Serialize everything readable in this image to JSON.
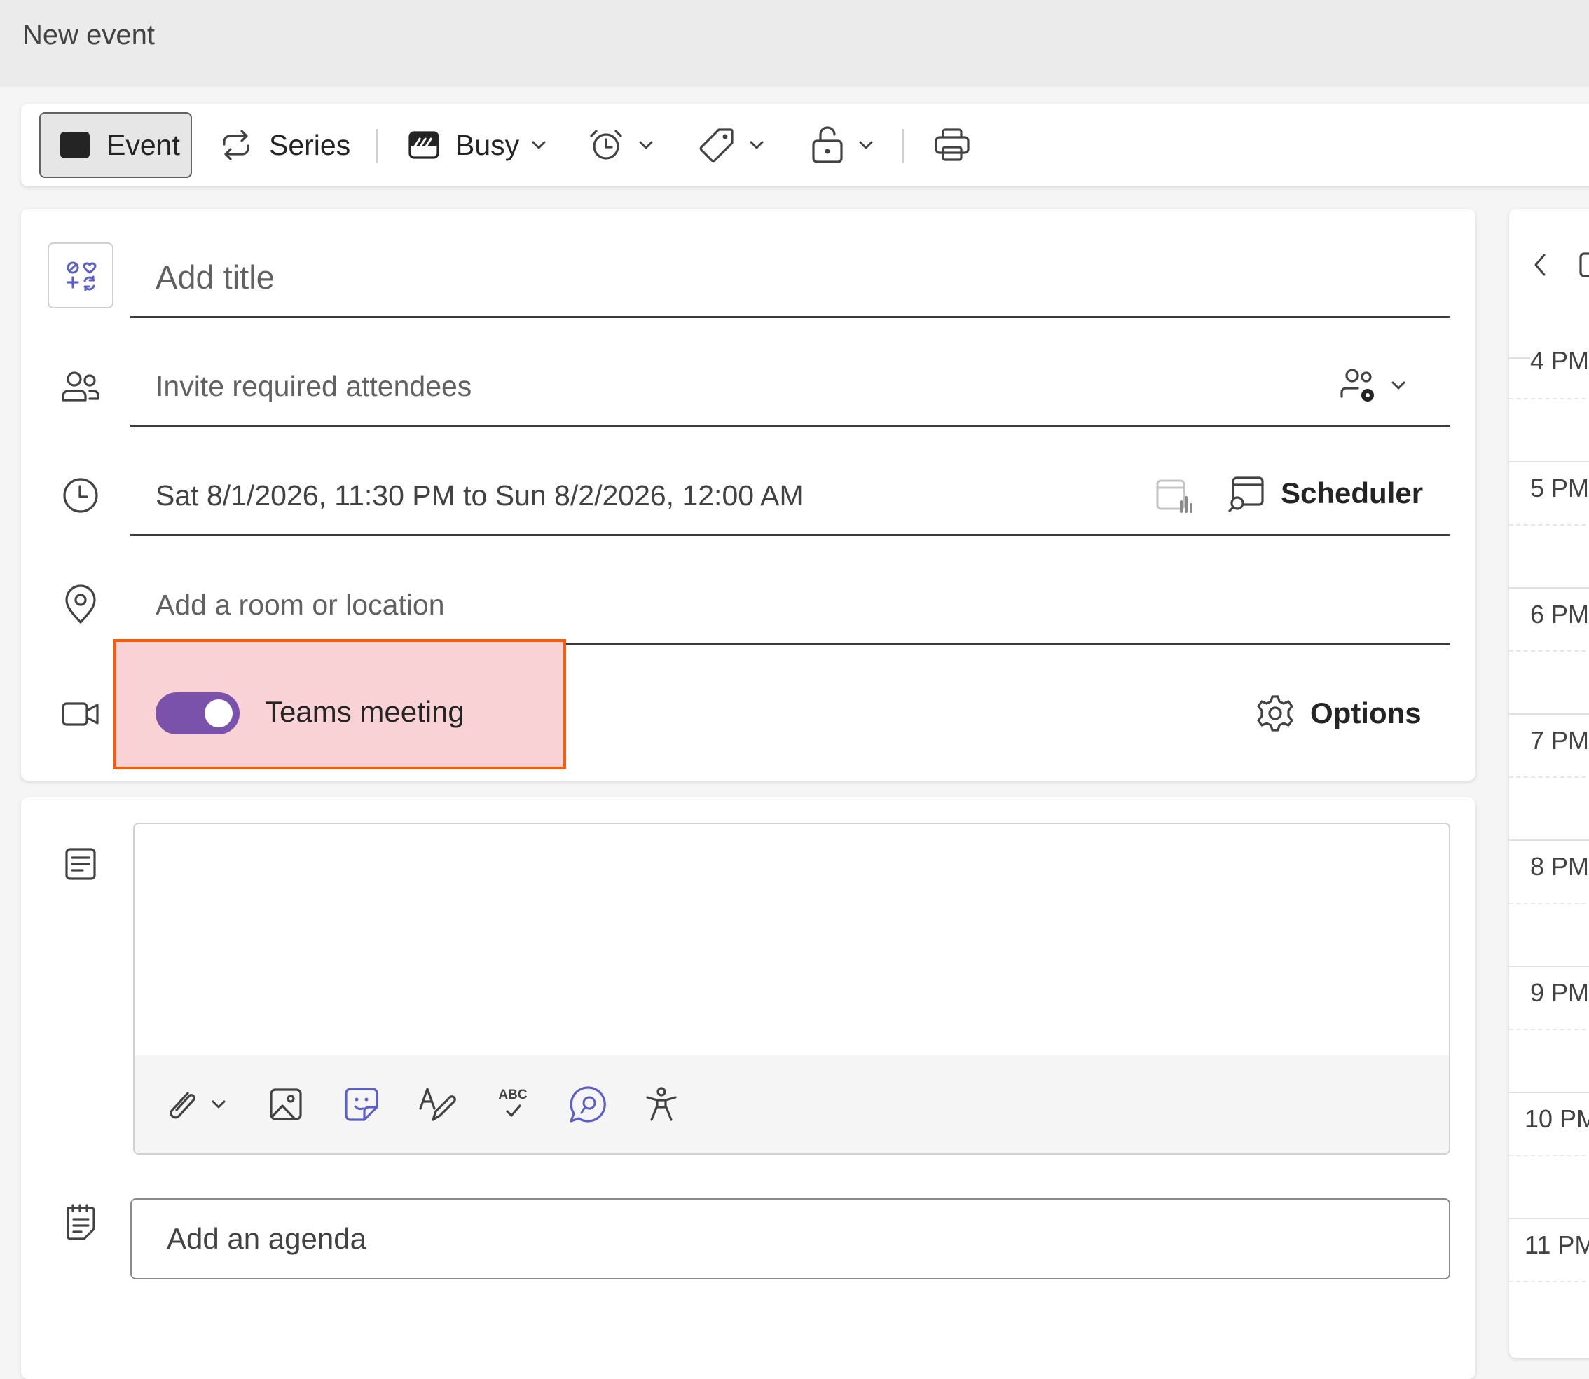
{
  "window": {
    "title": "New event"
  },
  "toolbar": {
    "event_label": "Event",
    "series_label": "Series",
    "show_as_label": "Busy"
  },
  "form": {
    "title_placeholder": "Add title",
    "attendees_placeholder": "Invite required attendees",
    "datetime_value": "Sat 8/1/2026, 11:30 PM to Sun 8/2/2026, 12:00 AM",
    "scheduler_label": "Scheduler",
    "location_placeholder": "Add a room or location",
    "teams_meeting_label": "Teams meeting",
    "teams_meeting_enabled": true,
    "options_label": "Options"
  },
  "body": {
    "agenda_placeholder": "Add an agenda"
  },
  "calendar": {
    "hours": [
      "4 PM",
      "5 PM",
      "6 PM",
      "7 PM",
      "8 PM",
      "9 PM",
      "10 PM",
      "11 PM"
    ]
  },
  "colors": {
    "accent": "#7b52ab",
    "highlight_fill": "#f8d2d4",
    "highlight_border": "#ff5a0a",
    "copilot_icon": "#5b5fc7"
  }
}
